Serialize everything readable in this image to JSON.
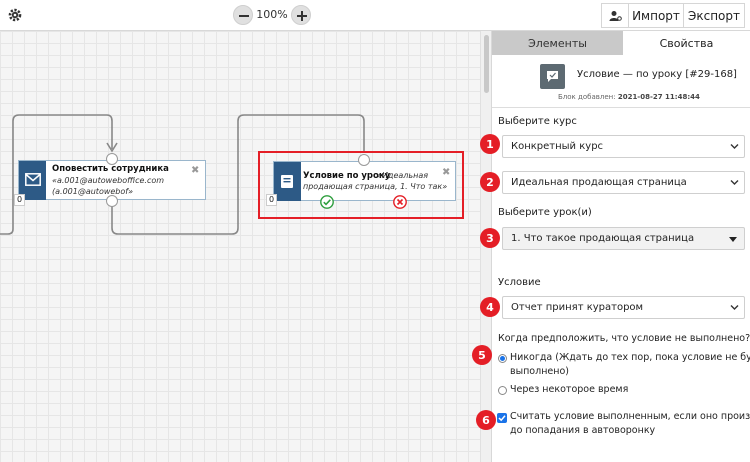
{
  "toolbar": {
    "zoom_value": "100%",
    "import_label": "Импорт",
    "export_label": "Экспорт"
  },
  "canvas": {
    "node_notify": {
      "title": "Оповестить сотрудника",
      "line1": "«a.001@autoweboffice.com",
      "line2": "(a.001@autowebof»",
      "counter": "0"
    },
    "node_condition": {
      "title": "Условие по уроку",
      "line1_rest": "«Идеальная",
      "line2": "продающая страница, 1. Что так»",
      "counter": "0"
    }
  },
  "panel": {
    "tabs": [
      "Элементы",
      "Свойства"
    ],
    "header": {
      "title": "Условие — по уроку [#29-168]",
      "added_label": "Блок добавлен:",
      "added_value": "2021-08-27 11:48:44"
    },
    "course_label": "Выберите курс",
    "course_type": "Конкретный курс",
    "course_name": "Идеальная продающая страница",
    "lesson_label": "Выберите урок(и)",
    "lesson_value": "1. Что такое продающая страница",
    "condition_label": "Условие",
    "condition_value": "Отчет принят куратором",
    "assume_label": "Когда предположить, что условие не выполнено?",
    "radio_never_line1": "Никогда (Ждать до тех пор, пока условие не будет",
    "radio_never_line2": "выполнено)",
    "radio_after": "Через некоторое время",
    "checkbox_line1": "Считать условие выполненным, если оно произошло,",
    "checkbox_line2": "до попадания в автоворонку",
    "badges": [
      "1",
      "2",
      "3",
      "4",
      "5",
      "6"
    ]
  },
  "colors": {
    "accent": "#e41e26",
    "node_icon": "#2d5a86",
    "check_green": "#2e9e3e",
    "cross_red": "#e41e26",
    "control_blue": "#1a73e8"
  }
}
